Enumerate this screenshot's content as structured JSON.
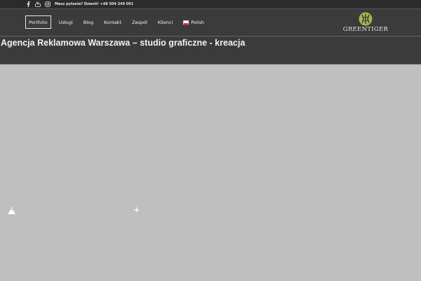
{
  "topbar": {
    "icons": [
      "facebook-icon",
      "youtube-icon",
      "instagram-icon"
    ],
    "contact_text": "Masz pytania? Dzwoń! +48 504 349 001"
  },
  "nav": {
    "items": [
      {
        "label": "Portfolio",
        "active": true
      },
      {
        "label": "Usługi"
      },
      {
        "label": "Blog"
      },
      {
        "label": "Kontakt"
      },
      {
        "label": "Zespół"
      },
      {
        "label": "Klienci"
      }
    ],
    "language": {
      "label": "Polish",
      "flag": "pl-flag-icon"
    }
  },
  "logo": {
    "text": "GREENTIGER",
    "accent": "#9fb847"
  },
  "page": {
    "title": "Agencja Reklamowa Warszawa – studio graficzne - kreacja"
  },
  "colors": {
    "header_bg": "#3b3b3b",
    "topbar_bg": "#2b2b2b",
    "content_bg": "#bfbfbf"
  }
}
